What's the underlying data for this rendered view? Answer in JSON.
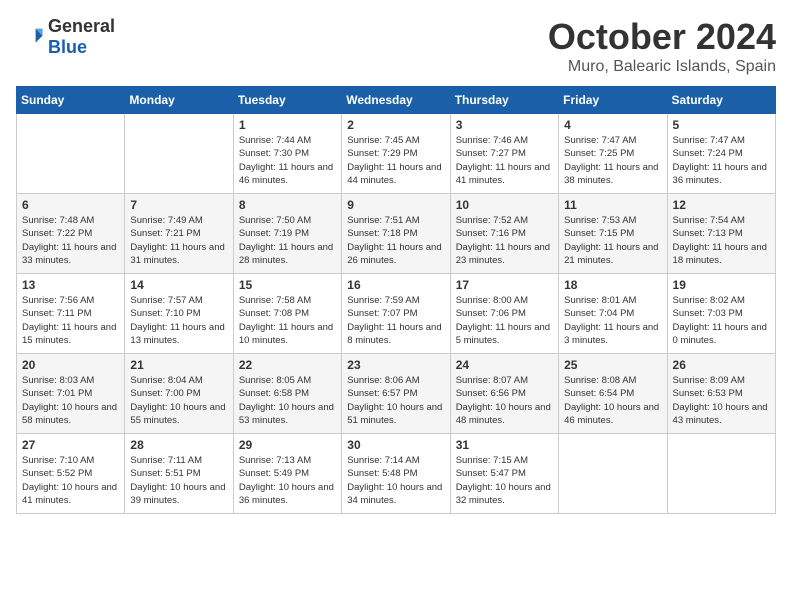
{
  "logo": {
    "general": "General",
    "blue": "Blue"
  },
  "title": "October 2024",
  "location": "Muro, Balearic Islands, Spain",
  "weekdays": [
    "Sunday",
    "Monday",
    "Tuesday",
    "Wednesday",
    "Thursday",
    "Friday",
    "Saturday"
  ],
  "weeks": [
    [
      {
        "day": "",
        "content": ""
      },
      {
        "day": "",
        "content": ""
      },
      {
        "day": "1",
        "sunrise": "Sunrise: 7:44 AM",
        "sunset": "Sunset: 7:30 PM",
        "daylight": "Daylight: 11 hours and 46 minutes."
      },
      {
        "day": "2",
        "sunrise": "Sunrise: 7:45 AM",
        "sunset": "Sunset: 7:29 PM",
        "daylight": "Daylight: 11 hours and 44 minutes."
      },
      {
        "day": "3",
        "sunrise": "Sunrise: 7:46 AM",
        "sunset": "Sunset: 7:27 PM",
        "daylight": "Daylight: 11 hours and 41 minutes."
      },
      {
        "day": "4",
        "sunrise": "Sunrise: 7:47 AM",
        "sunset": "Sunset: 7:25 PM",
        "daylight": "Daylight: 11 hours and 38 minutes."
      },
      {
        "day": "5",
        "sunrise": "Sunrise: 7:47 AM",
        "sunset": "Sunset: 7:24 PM",
        "daylight": "Daylight: 11 hours and 36 minutes."
      }
    ],
    [
      {
        "day": "6",
        "sunrise": "Sunrise: 7:48 AM",
        "sunset": "Sunset: 7:22 PM",
        "daylight": "Daylight: 11 hours and 33 minutes."
      },
      {
        "day": "7",
        "sunrise": "Sunrise: 7:49 AM",
        "sunset": "Sunset: 7:21 PM",
        "daylight": "Daylight: 11 hours and 31 minutes."
      },
      {
        "day": "8",
        "sunrise": "Sunrise: 7:50 AM",
        "sunset": "Sunset: 7:19 PM",
        "daylight": "Daylight: 11 hours and 28 minutes."
      },
      {
        "day": "9",
        "sunrise": "Sunrise: 7:51 AM",
        "sunset": "Sunset: 7:18 PM",
        "daylight": "Daylight: 11 hours and 26 minutes."
      },
      {
        "day": "10",
        "sunrise": "Sunrise: 7:52 AM",
        "sunset": "Sunset: 7:16 PM",
        "daylight": "Daylight: 11 hours and 23 minutes."
      },
      {
        "day": "11",
        "sunrise": "Sunrise: 7:53 AM",
        "sunset": "Sunset: 7:15 PM",
        "daylight": "Daylight: 11 hours and 21 minutes."
      },
      {
        "day": "12",
        "sunrise": "Sunrise: 7:54 AM",
        "sunset": "Sunset: 7:13 PM",
        "daylight": "Daylight: 11 hours and 18 minutes."
      }
    ],
    [
      {
        "day": "13",
        "sunrise": "Sunrise: 7:56 AM",
        "sunset": "Sunset: 7:11 PM",
        "daylight": "Daylight: 11 hours and 15 minutes."
      },
      {
        "day": "14",
        "sunrise": "Sunrise: 7:57 AM",
        "sunset": "Sunset: 7:10 PM",
        "daylight": "Daylight: 11 hours and 13 minutes."
      },
      {
        "day": "15",
        "sunrise": "Sunrise: 7:58 AM",
        "sunset": "Sunset: 7:08 PM",
        "daylight": "Daylight: 11 hours and 10 minutes."
      },
      {
        "day": "16",
        "sunrise": "Sunrise: 7:59 AM",
        "sunset": "Sunset: 7:07 PM",
        "daylight": "Daylight: 11 hours and 8 minutes."
      },
      {
        "day": "17",
        "sunrise": "Sunrise: 8:00 AM",
        "sunset": "Sunset: 7:06 PM",
        "daylight": "Daylight: 11 hours and 5 minutes."
      },
      {
        "day": "18",
        "sunrise": "Sunrise: 8:01 AM",
        "sunset": "Sunset: 7:04 PM",
        "daylight": "Daylight: 11 hours and 3 minutes."
      },
      {
        "day": "19",
        "sunrise": "Sunrise: 8:02 AM",
        "sunset": "Sunset: 7:03 PM",
        "daylight": "Daylight: 11 hours and 0 minutes."
      }
    ],
    [
      {
        "day": "20",
        "sunrise": "Sunrise: 8:03 AM",
        "sunset": "Sunset: 7:01 PM",
        "daylight": "Daylight: 10 hours and 58 minutes."
      },
      {
        "day": "21",
        "sunrise": "Sunrise: 8:04 AM",
        "sunset": "Sunset: 7:00 PM",
        "daylight": "Daylight: 10 hours and 55 minutes."
      },
      {
        "day": "22",
        "sunrise": "Sunrise: 8:05 AM",
        "sunset": "Sunset: 6:58 PM",
        "daylight": "Daylight: 10 hours and 53 minutes."
      },
      {
        "day": "23",
        "sunrise": "Sunrise: 8:06 AM",
        "sunset": "Sunset: 6:57 PM",
        "daylight": "Daylight: 10 hours and 51 minutes."
      },
      {
        "day": "24",
        "sunrise": "Sunrise: 8:07 AM",
        "sunset": "Sunset: 6:56 PM",
        "daylight": "Daylight: 10 hours and 48 minutes."
      },
      {
        "day": "25",
        "sunrise": "Sunrise: 8:08 AM",
        "sunset": "Sunset: 6:54 PM",
        "daylight": "Daylight: 10 hours and 46 minutes."
      },
      {
        "day": "26",
        "sunrise": "Sunrise: 8:09 AM",
        "sunset": "Sunset: 6:53 PM",
        "daylight": "Daylight: 10 hours and 43 minutes."
      }
    ],
    [
      {
        "day": "27",
        "sunrise": "Sunrise: 7:10 AM",
        "sunset": "Sunset: 5:52 PM",
        "daylight": "Daylight: 10 hours and 41 minutes."
      },
      {
        "day": "28",
        "sunrise": "Sunrise: 7:11 AM",
        "sunset": "Sunset: 5:51 PM",
        "daylight": "Daylight: 10 hours and 39 minutes."
      },
      {
        "day": "29",
        "sunrise": "Sunrise: 7:13 AM",
        "sunset": "Sunset: 5:49 PM",
        "daylight": "Daylight: 10 hours and 36 minutes."
      },
      {
        "day": "30",
        "sunrise": "Sunrise: 7:14 AM",
        "sunset": "Sunset: 5:48 PM",
        "daylight": "Daylight: 10 hours and 34 minutes."
      },
      {
        "day": "31",
        "sunrise": "Sunrise: 7:15 AM",
        "sunset": "Sunset: 5:47 PM",
        "daylight": "Daylight: 10 hours and 32 minutes."
      },
      {
        "day": "",
        "content": ""
      },
      {
        "day": "",
        "content": ""
      }
    ]
  ]
}
